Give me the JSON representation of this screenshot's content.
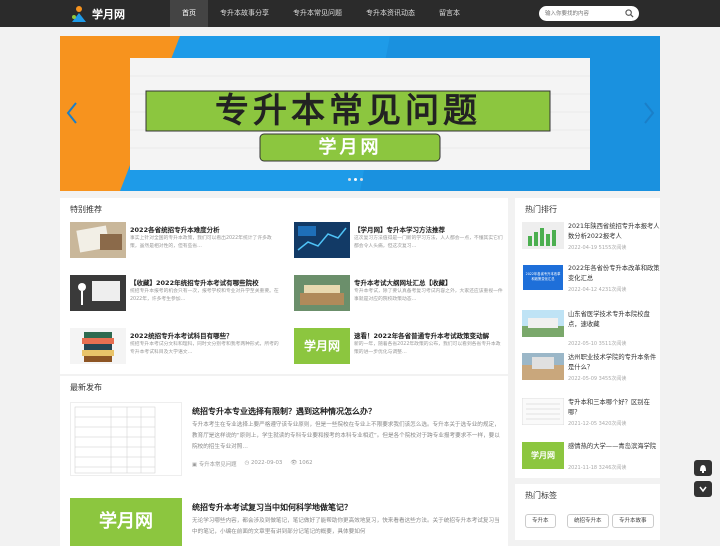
{
  "site": {
    "name": "学月网"
  },
  "nav": [
    "首页",
    "专升本故事分享",
    "专升本常见问题",
    "专升本资讯动态",
    "留言本"
  ],
  "search": {
    "placeholder": "输入你要找的内容"
  },
  "banner": {
    "headline": "专升本常见问题",
    "badge": "学月网"
  },
  "recommend": {
    "title": "特别推荐",
    "items": [
      {
        "title": "2022各省统招专升本难度分析",
        "desc": "事实上针对全国的专升本政策，我们可以看出2022年统计了许多政策，虽然是相对性的，但有些省…"
      },
      {
        "title": "【学月网】专升本学习方法推荐",
        "desc": "这次复习方法值得是一门新的学习方法，人人都会一点，不懂其实它们都会令人头痛，但这次复习…"
      },
      {
        "title": "【收藏】2022年统招专升本考试有哪些院校",
        "desc": "统招专升本报考的机会只有一次，报考学校和专业对升学至关重要。在2022年，许多考生参加…"
      },
      {
        "title": "专升本考试大纲网址汇总【收藏】",
        "desc": "专升本考试，除了要认真备考复习考试内容之外，大家还应该重视一件事就是对应的院校政策动态…"
      },
      {
        "title": "2022统招专升本考试科目有哪些？",
        "desc": "统招专升本考试分文科和理科，同时文分别考和我考两种形式，所考的专升本考试科目及大学语文…"
      },
      {
        "title": "速看！2022年各省普通专升本考试政策变动解",
        "desc": "新的一年，随着各省2022年政策的公布，我们可以看到各省专升本政策的进一步优化与调整…"
      }
    ]
  },
  "latest": {
    "title": "最新发布",
    "items": [
      {
        "title": "统招专升本专业选择有限制？遇到这种情况怎么办？",
        "desc": "专升本考生在专业选择上要严格遵守该专业原则，但是一些院校在专业上不限要求我们该怎么选。专升本关于选专业的规定，教育厅是这样说的“原则上，学生就读的专科专业要和报考的本科专业相近”。但是各个院校对于跨专业报考要求不一样，要以院校的招生专业对照…",
        "category": "专升本常见问题",
        "date": "2022-09-03",
        "views": "1062"
      },
      {
        "title": "统招专升本考试复习当中如何科学地做笔记？",
        "desc": "无论学习哪些内容，都会涉及到做笔记，笔记做好了能帮助你更高效地复习，快来看看这些方法。关于统招专升本考试复习当中的笔记，小编在前面的文章里有讲到部分记笔记的概要，具体要如何"
      }
    ]
  },
  "hot": {
    "title": "热门排行",
    "items": [
      {
        "title": "2021年陕西省统招专升本报考人数分析2022报考人",
        "date": "2022-04-19",
        "views": "5155次阅读"
      },
      {
        "title": "2022年各省份专升本改革和政策变化汇总",
        "date": "2022-04-12",
        "thumb_text": "2022年各省专升本改革和政策变化汇总",
        "views": "4231次阅读"
      },
      {
        "title": "山东省医学技术专升本院校盘点，速收藏",
        "date": "2022-05-10",
        "views": "3511次阅读"
      },
      {
        "title": "达州职业技术学院的专升本条件是什么？",
        "date": "2022-05-09",
        "views": "3455次阅读"
      },
      {
        "title": "专升本和三本哪个好？区别在哪？",
        "date": "2021-12-05",
        "views": "3420次阅读"
      },
      {
        "title": "感情热的大学——青岛滨海学院",
        "date": "2021-11-18",
        "views": "3246次阅读"
      }
    ]
  },
  "tags": {
    "title": "热门标签",
    "items": [
      "专升本",
      "统招专升本",
      "专升本故事"
    ]
  },
  "colors": {
    "green": "#8cc63f",
    "blue": "#1e9be8",
    "orange": "#f7931e",
    "dark": "#2b2b2b"
  }
}
